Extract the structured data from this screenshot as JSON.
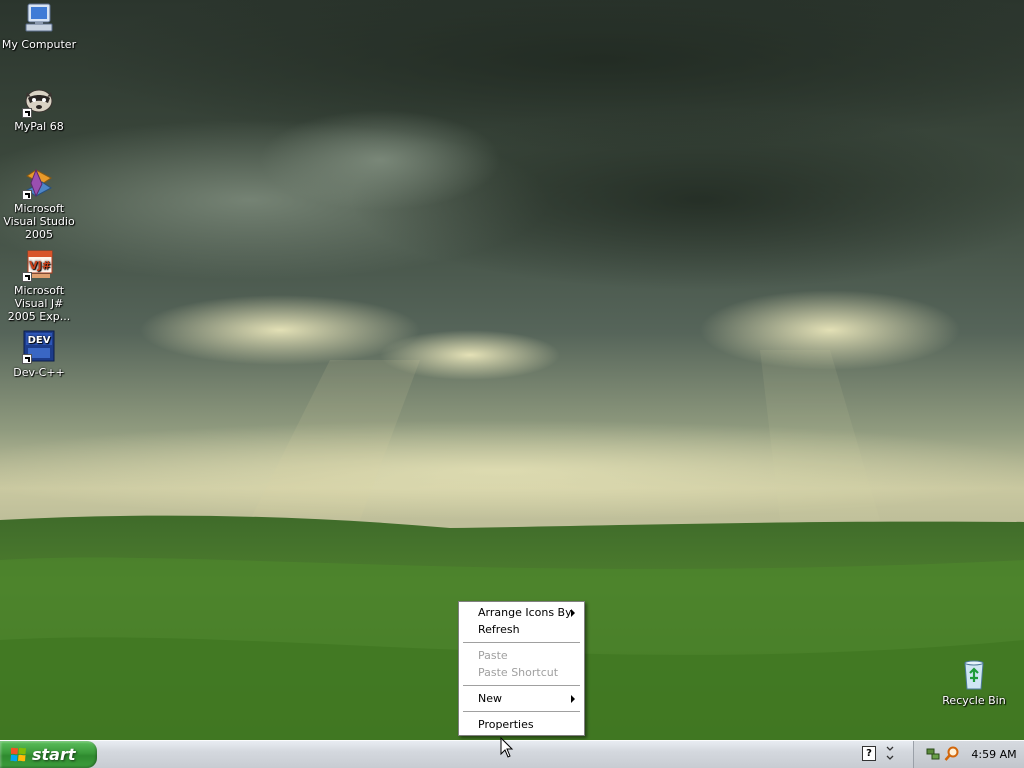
{
  "desktop": {
    "icons": [
      {
        "label": "My Computer",
        "icon": "my-computer-icon"
      },
      {
        "label": "MyPal 68",
        "icon": "mypal-icon"
      },
      {
        "label": "Microsoft Visual Studio 2005",
        "icon": "visual-studio-icon"
      },
      {
        "label": "Microsoft Visual J# 2005 Exp...",
        "icon": "visual-jsharp-icon"
      },
      {
        "label": "Dev-C++",
        "icon": "dev-cpp-icon"
      },
      {
        "label": "Recycle Bin",
        "icon": "recycle-bin-icon"
      }
    ]
  },
  "context_menu": {
    "items": [
      {
        "label": "Arrange Icons By",
        "enabled": true,
        "submenu": true
      },
      {
        "label": "Refresh",
        "enabled": true,
        "submenu": false
      },
      {
        "label": "Paste",
        "enabled": false,
        "submenu": false
      },
      {
        "label": "Paste Shortcut",
        "enabled": false,
        "submenu": false
      },
      {
        "label": "New",
        "enabled": true,
        "submenu": true
      },
      {
        "label": "Properties",
        "enabled": true,
        "submenu": false
      }
    ]
  },
  "taskbar": {
    "start_label": "start",
    "help_icon_text": "?",
    "clock": "4:59 AM"
  },
  "colors": {
    "start_green": "#3a9a3a",
    "taskbar_gray": "#d4d8de",
    "menu_disabled": "#a0a0a0"
  }
}
